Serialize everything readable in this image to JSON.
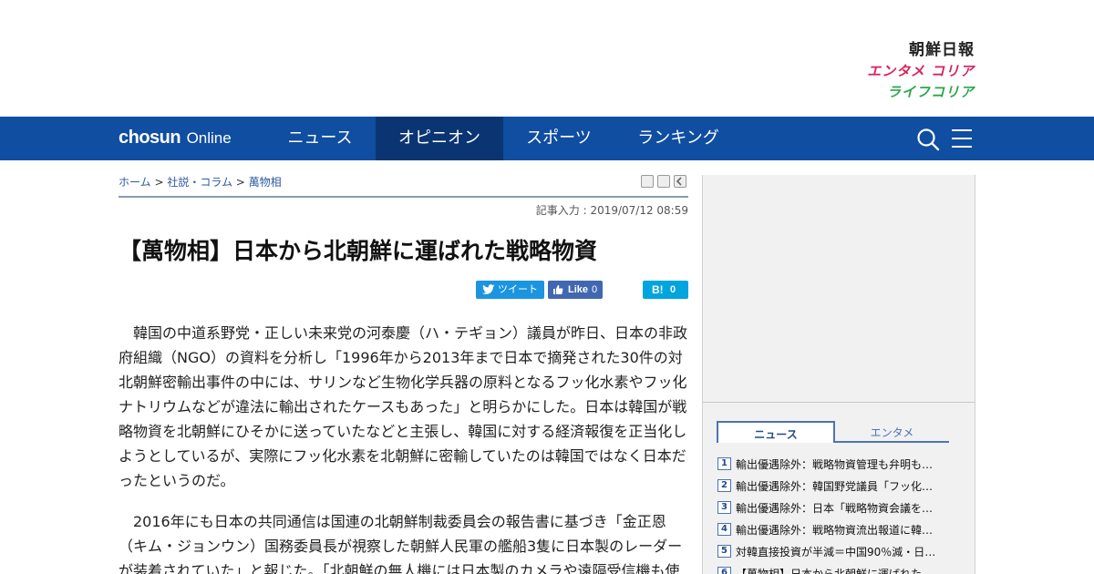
{
  "logos": {
    "chosun": "朝鮮日報",
    "entame": "エンタメ コリア",
    "life": "ライフコリア"
  },
  "nav": {
    "brand_main": "chosun",
    "brand_sub": "Online",
    "items": [
      "ニュース",
      "オピニオン",
      "スポーツ",
      "ランキング"
    ],
    "active_item": "オピニオン",
    "icons": [
      "search-icon",
      "menu-icon"
    ]
  },
  "breadcrumb": {
    "home": "ホーム",
    "sep": " > ",
    "section": "社説・コラム",
    "current": "萬物相"
  },
  "article": {
    "date": "記事入力 : 2019/07/12 08:59",
    "headline": "【萬物相】日本から北朝鮮に運ばれた戦略物資",
    "paragraphs": [
      "韓国の中道系野党・正しい未来党の河泰慶（ハ・テギョン）議員が昨日、日本の非政府組織（NGO）の資料を分析し「1996年から2013年まで日本で摘発された30件の対北朝鮮密輸出事件の中には、サリンなど生物化学兵器の原料となるフッ化水素やフッ化ナトリウムなどが違法に輸出されたケースもあった」と明らかにした。日本は韓国が戦略物資を北朝鮮にひそかに送っていたなどと主張し、韓国に対する経済報復を正当化しようとしているが、実際にフッ化水素を北朝鮮に密輸していたのは韓国ではなく日本だったというのだ。",
      "2016年にも日本の共同通信は国連の北朝鮮制裁委員会の報告書に基づき「金正恩（キム・ジョンウン）国務委員長が視察した朝鮮人民軍の艦船3隻に日本製のレーダーが装着されていた」と報じた。「北朝鮮の無人機には日本製のカメラや遠隔受信機も使"
    ]
  },
  "social": {
    "tweet": "ツイート",
    "like": "Like",
    "like_count": "0",
    "hatena": "B!",
    "hatena_count": "0"
  },
  "sidebar": {
    "tabs": [
      "ニュース",
      "エンタメ"
    ],
    "active_tab": "ニュース",
    "ranking": [
      {
        "rank": "1",
        "title": "輸出優遇除外：戦略物資管理も弁明も…"
      },
      {
        "rank": "2",
        "title": "輸出優遇除外：韓国野党議員「フッ化…"
      },
      {
        "rank": "3",
        "title": "輸出優遇除外：日本「戦略物資会議を…"
      },
      {
        "rank": "4",
        "title": "輸出優遇除外：戦略物資流出報道に韓…"
      },
      {
        "rank": "5",
        "title": "対韓直接投資が半減＝中国90％減・日…"
      },
      {
        "rank": "6",
        "title": "【萬物相】日本から北朝鮮に運ばれた…"
      }
    ]
  },
  "colors": {
    "nav_bg": "#0f4ea1",
    "nav_active": "#0a3572",
    "link": "#2c5aa0",
    "tweet": "#1b95e0",
    "facebook": "#4267b2",
    "hatena": "#00a4de"
  }
}
